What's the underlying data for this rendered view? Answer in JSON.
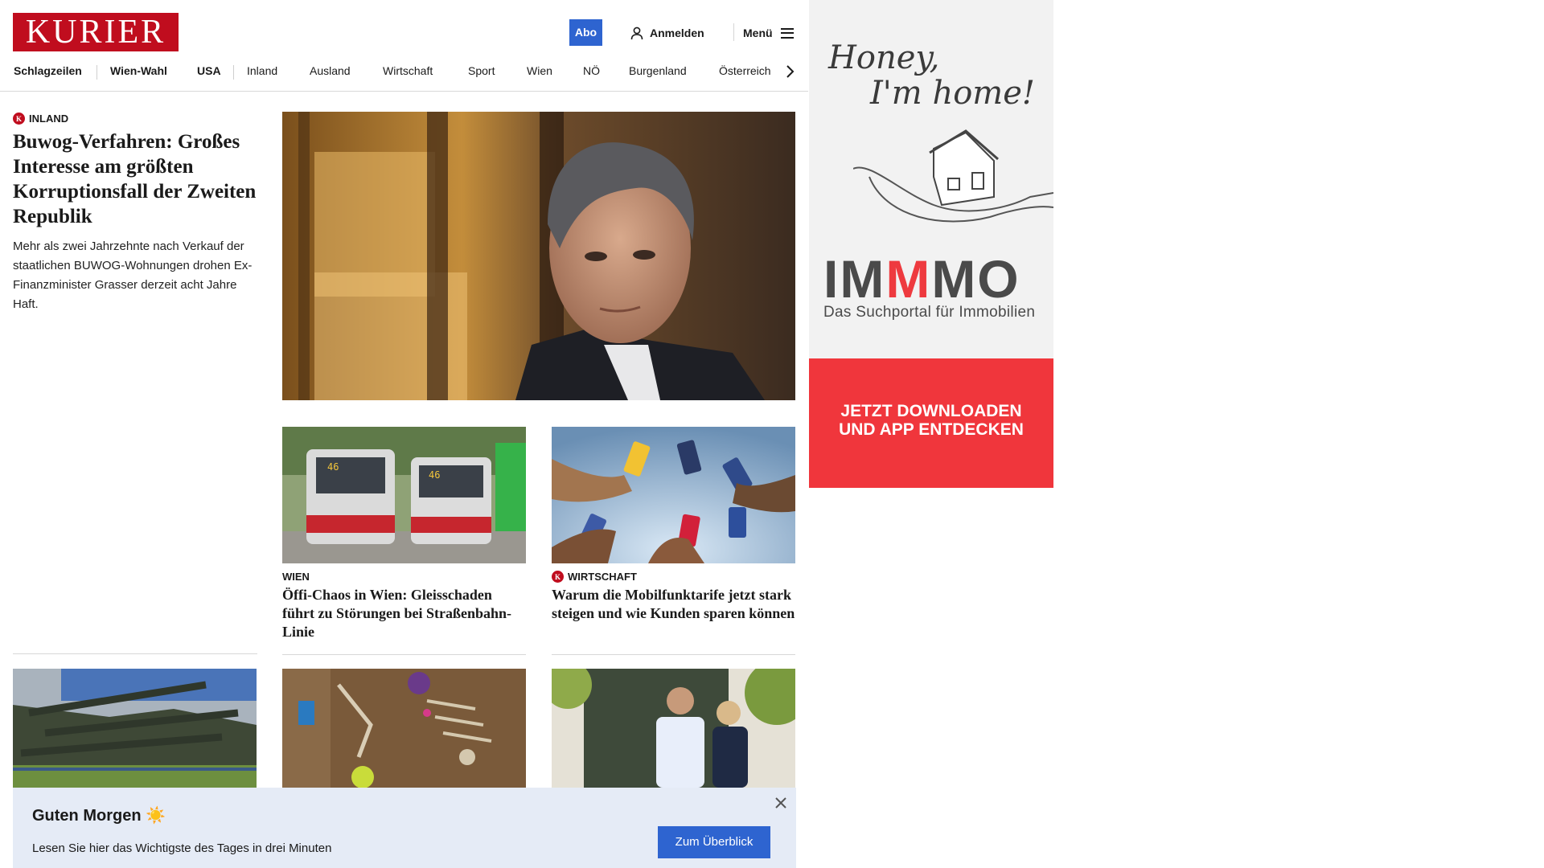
{
  "header": {
    "logo_text": "KURIER",
    "abo_label": "Abo",
    "login_label": "Anmelden",
    "menu_label": "Menü"
  },
  "nav": {
    "items": [
      {
        "label": "Schlagzeilen",
        "bold": true
      },
      {
        "label": "Wien-Wahl",
        "bold": true
      },
      {
        "label": "USA",
        "bold": true
      },
      {
        "label": "Inland",
        "bold": false
      },
      {
        "label": "Ausland",
        "bold": false
      },
      {
        "label": "Wirtschaft",
        "bold": false
      },
      {
        "label": "Sport",
        "bold": false
      },
      {
        "label": "Wien",
        "bold": false
      },
      {
        "label": "NÖ",
        "bold": false
      },
      {
        "label": "Burgenland",
        "bold": false
      },
      {
        "label": "Österreich",
        "bold": false
      }
    ]
  },
  "lead": {
    "category": "INLAND",
    "badge": "K",
    "title": "Buwog-Verfahren: Großes Interesse am größten Korruptionsfall der Zweiten Republik",
    "teaser": "Mehr als zwei Jahrzehnte nach Verkauf der staatlichen BUWOG-Wohnungen drohen Ex-Finanzminister Grasser derzeit acht Jahre Haft."
  },
  "teasers": [
    {
      "category": "WIEN",
      "premium": false,
      "title": "Öffi-Chaos in Wien: Gleisschaden führt zu Störungen bei Straßenbahn-Linie"
    },
    {
      "category": "WIRTSCHAFT",
      "premium": true,
      "badge": "K",
      "title": "Warum die Mobilfunktarife jetzt stark steigen und wie Kunden sparen können"
    }
  ],
  "banner": {
    "title": "Guten Morgen ☀️",
    "subtitle": "Lesen Sie hier das Wichtigste des Tages in drei Minuten",
    "button_label": "Zum Überblick"
  },
  "ad": {
    "script_line1": "Honey,",
    "script_line2": "I'm home!",
    "brand_part1": "IM",
    "brand_part2": "M",
    "brand_part3": "MO",
    "tagline": "Das Suchportal für Immobilien",
    "cta_line1": "JETZT DOWNLOADEN",
    "cta_line2": "UND APP ENTDECKEN"
  },
  "colors": {
    "brand_red": "#c00d1e",
    "button_blue": "#2e64d0",
    "ad_red": "#f0363c",
    "banner_bg": "#e5ebf6"
  }
}
